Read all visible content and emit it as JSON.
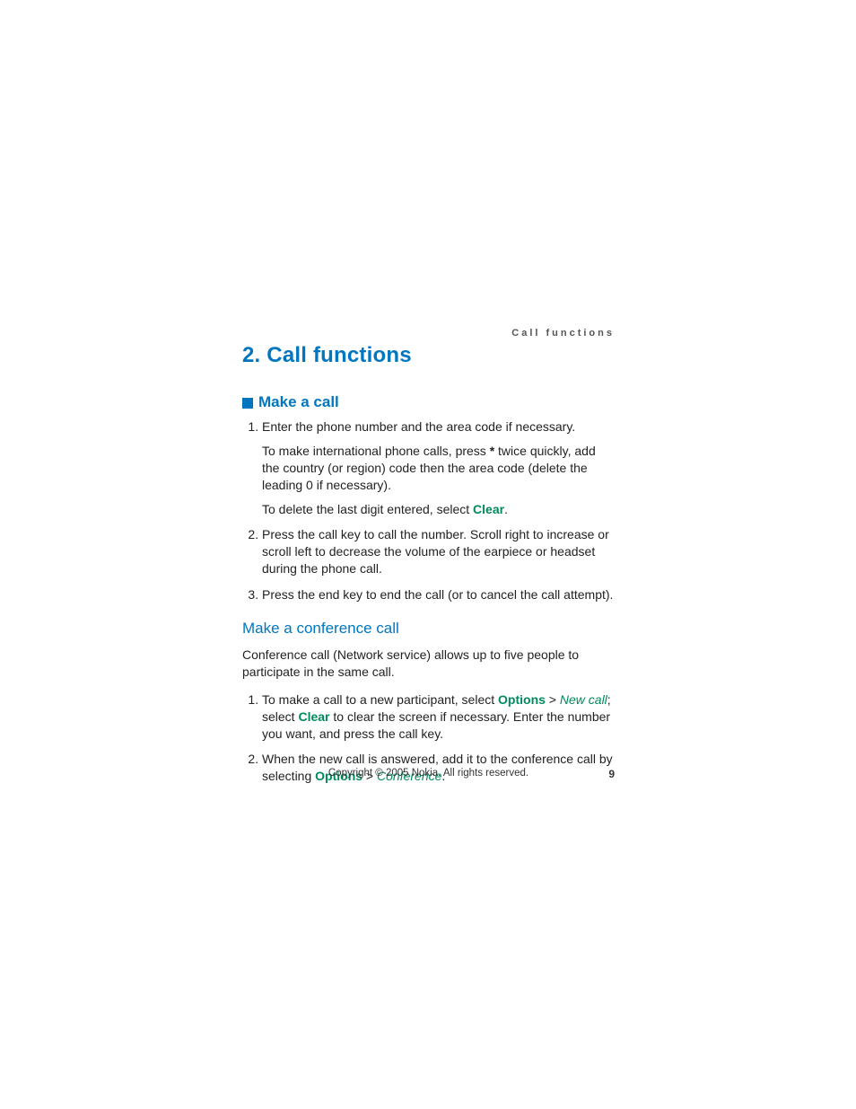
{
  "running_header": "Call functions",
  "section_title": "2. Call functions",
  "h2_make_a_call": "Make a call",
  "list1": {
    "item1": {
      "p1": "Enter the phone number and the area code if necessary.",
      "p2_a": "To make international phone calls, press ",
      "p2_star": "*",
      "p2_b": " twice quickly, add the country (or region) code then the area code (delete the leading 0 if necessary).",
      "p3_a": "To delete the last digit entered, select ",
      "p3_clear": "Clear",
      "p3_b": "."
    },
    "item2": "Press the call key to call the number. Scroll right to increase or scroll left to decrease the volume of the earpiece or headset during the phone call.",
    "item3": "Press the end key to end the call (or to cancel the call attempt)."
  },
  "h3_conference": "Make a conference call",
  "conference_intro": "Conference call (Network service) allows up to five people to participate in the same call.",
  "list2": {
    "item1": {
      "a": "To make a call to a new participant, select ",
      "options": "Options",
      "gt1": " > ",
      "newcall": "New call",
      "b": "; select ",
      "clear": "Clear",
      "c": " to clear the screen if necessary. Enter the number you want, and press the call key."
    },
    "item2": {
      "a": "When the new call is answered, add it to the conference call by selecting ",
      "options": "Options",
      "gt1": " > ",
      "conference": "Conference",
      "b": "."
    }
  },
  "footer": {
    "copyright": "Copyright © 2005 Nokia. All rights reserved.",
    "page": "9"
  }
}
